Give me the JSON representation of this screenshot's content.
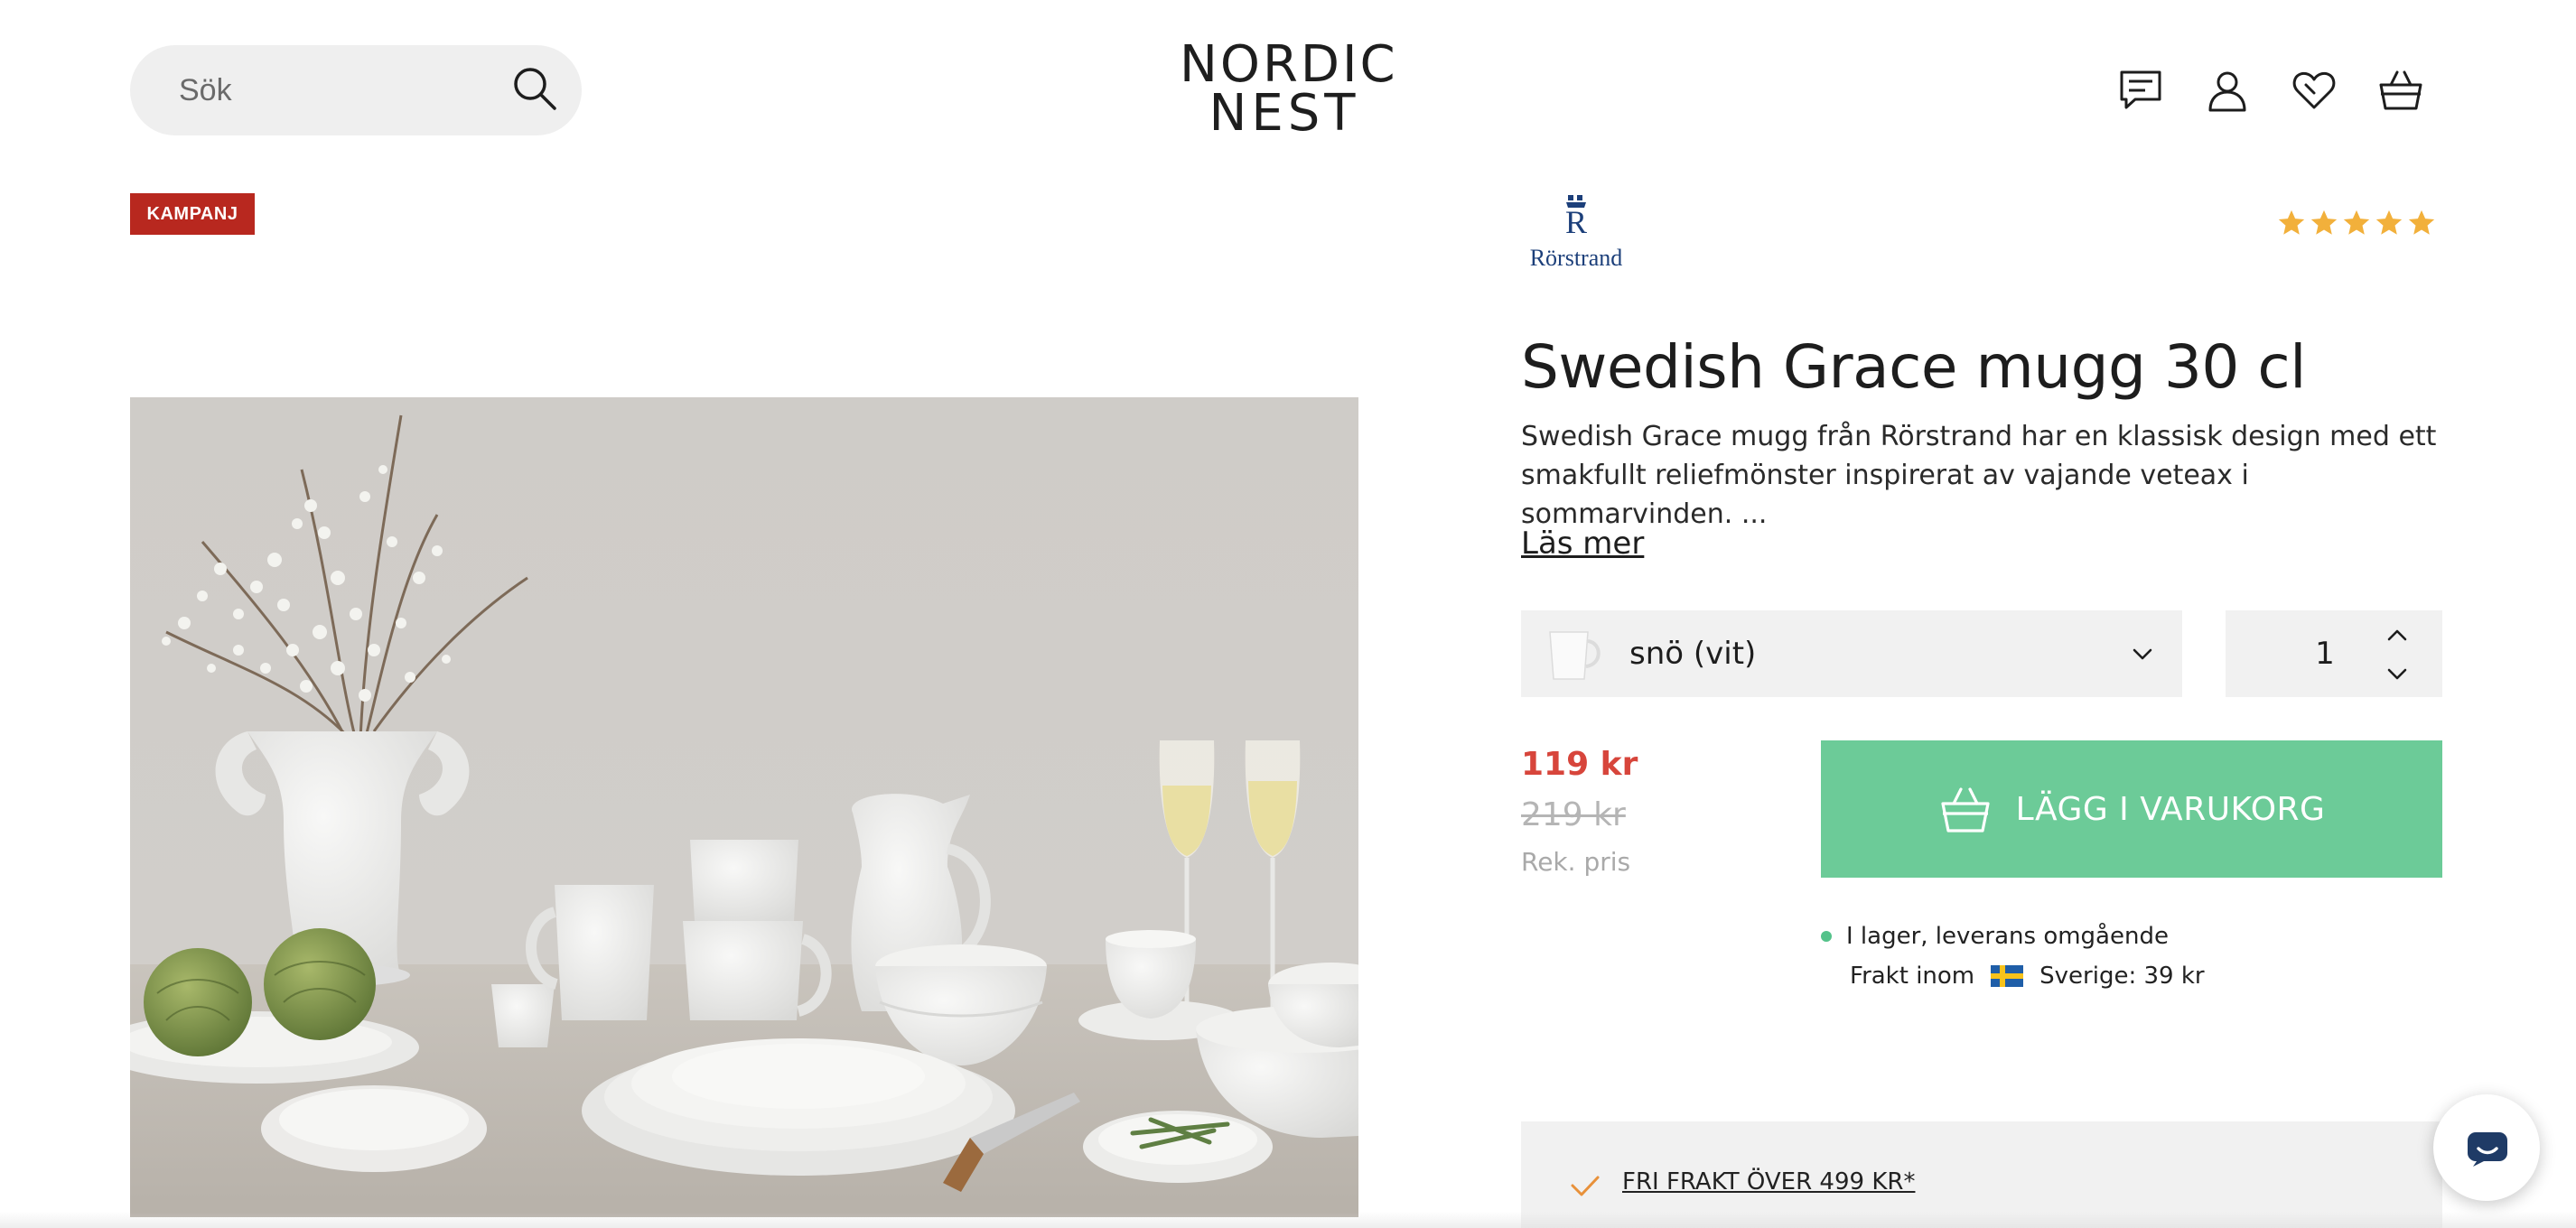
{
  "header": {
    "search_placeholder": "Sök",
    "logo_line1": "NORDIC",
    "logo_line2": "NEST",
    "icons": [
      "chat-icon",
      "account-icon",
      "wishlist-heart-icon",
      "basket-icon"
    ]
  },
  "gallery": {
    "badge": "KAMPANJ",
    "badge_color": "#b8281f"
  },
  "product": {
    "brand": "Rörstrand",
    "brand_color": "#1c3f7a",
    "rating_stars": 5,
    "star_color": "#f2b03b",
    "title": "Swedish Grace mugg 30 cl",
    "description_line1": "Swedish Grace mugg från Rörstrand har en klassisk design med ett",
    "description_line2": "smakfullt reliefmönster inspirerat av vajande veteax i sommarvinden. ...",
    "read_more": "Läs mer",
    "variant": "snö (vit)",
    "quantity": "1",
    "price": "119 kr",
    "price_color": "#d7453b",
    "old_price": "219 kr",
    "rek_label": "Rek. pris",
    "add_to_cart": "LÄGG I VARUKORG",
    "add_to_cart_color": "#6ccb98",
    "stock": "I lager, leverans omgående",
    "shipping_prefix": "Frakt inom",
    "shipping_suffix": "Sverige: 39 kr",
    "free_shipping": "FRI FRAKT ÖVER 499 KR*"
  }
}
